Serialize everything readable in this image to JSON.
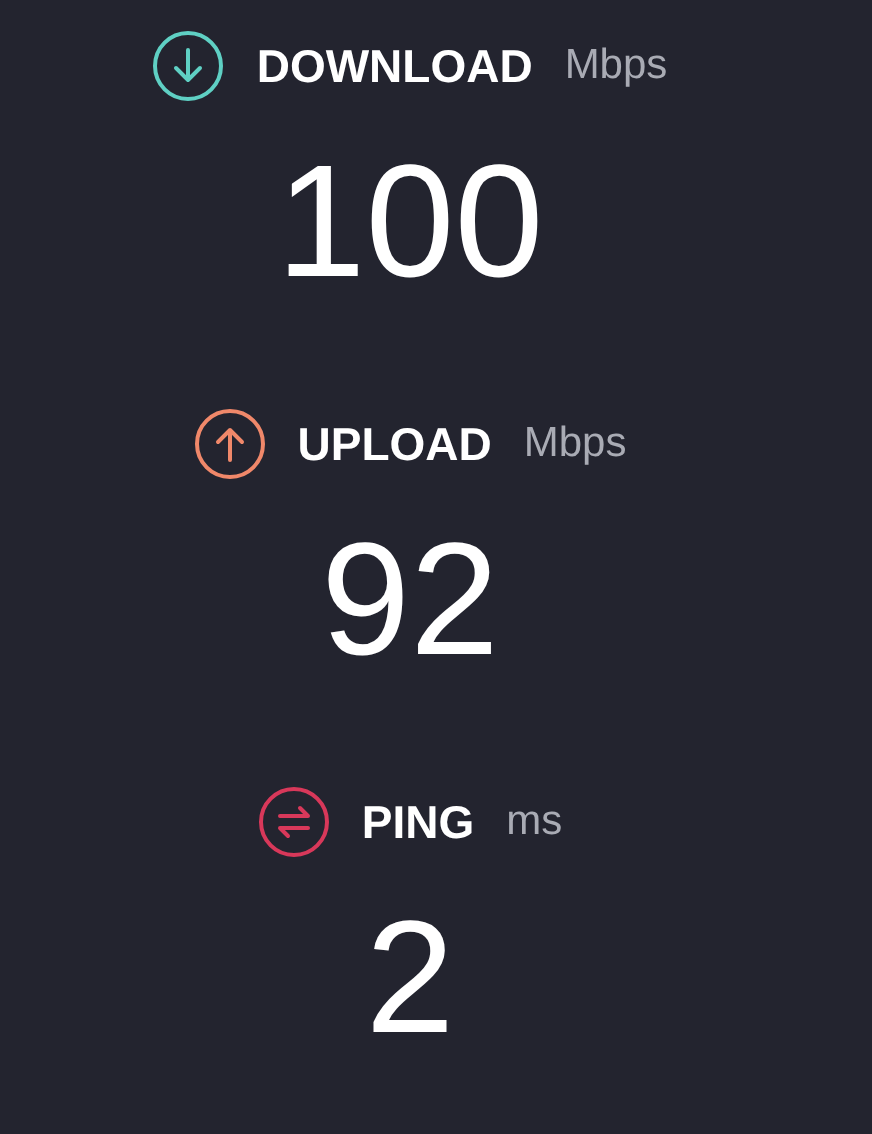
{
  "metrics": [
    {
      "kind": "download",
      "label": "DOWNLOAD",
      "unit": "Mbps",
      "value": "100",
      "color": "#5fd0c4"
    },
    {
      "kind": "upload",
      "label": "UPLOAD",
      "unit": "Mbps",
      "value": "92",
      "color": "#f0886a"
    },
    {
      "kind": "ping",
      "label": "PING",
      "unit": "ms",
      "value": "2",
      "color": "#d8385a"
    }
  ]
}
